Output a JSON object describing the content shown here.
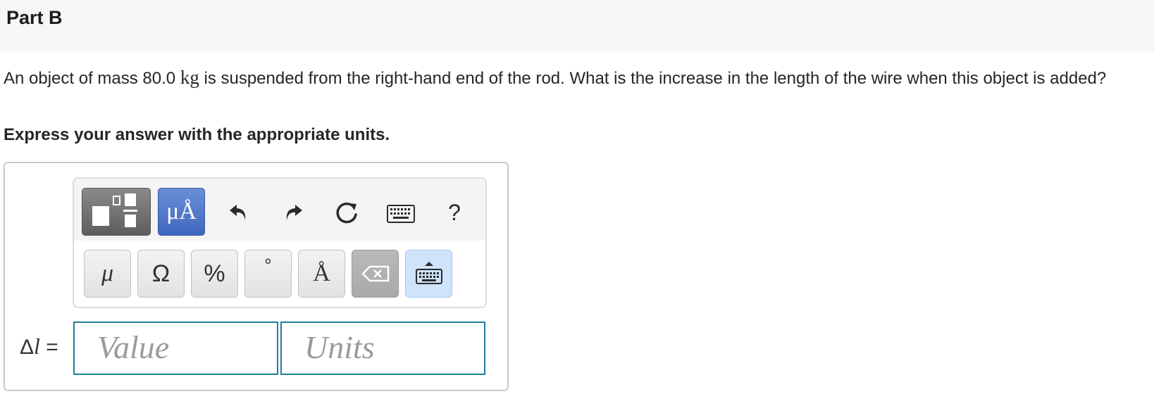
{
  "part": {
    "title": "Part B"
  },
  "question": {
    "text_before": "An object of mass 80.0 ",
    "unit": "kg",
    "text_after": " is suspended from the right-hand end of the rod. What is the increase in the length of the wire when this object is added?"
  },
  "instruction": "Express your answer with the appropriate units.",
  "toolbar": {
    "templates_icon": "fraction-templates-icon",
    "units_button": "μÅ",
    "undo_icon": "undo-icon",
    "redo_icon": "redo-icon",
    "reset_icon": "reset-icon",
    "keyboard_icon": "keyboard-icon",
    "help": "?"
  },
  "keys": {
    "mu": "μ",
    "omega": "Ω",
    "percent": "%",
    "degree": "°",
    "angstrom": "Å",
    "delete_icon": "backspace-icon",
    "keyboard_toggle_icon": "keyboard-toggle-icon"
  },
  "answer": {
    "label": "Δl =",
    "label_symbol": "Δ",
    "label_var": "l",
    "label_eq": " =",
    "value_placeholder": "Value",
    "units_placeholder": "Units"
  },
  "colors": {
    "units_button": "#4a6fc7",
    "field_border": "#217c9b",
    "keyboard_key": "#cfe3fb"
  }
}
